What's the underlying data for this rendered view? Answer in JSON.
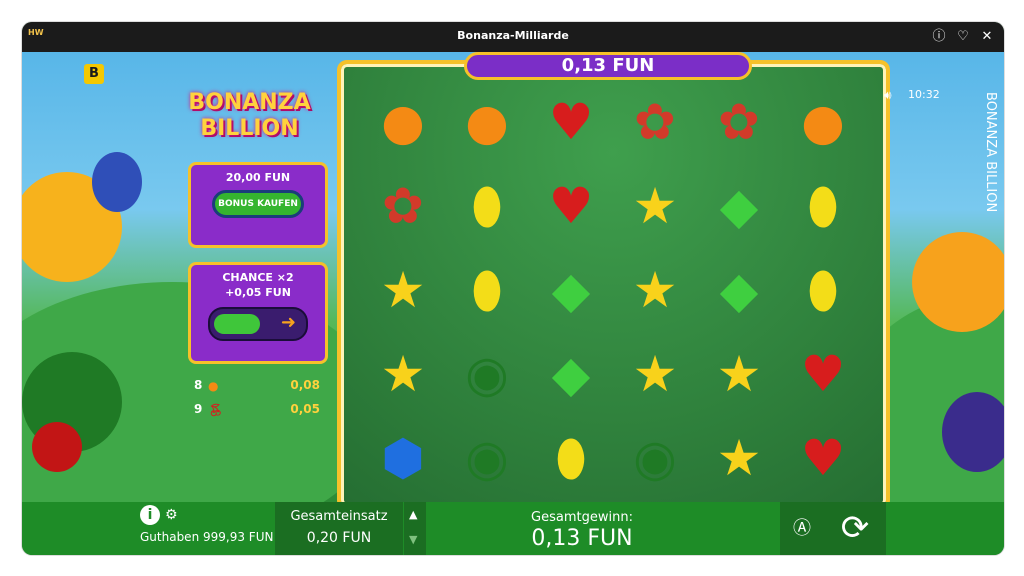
{
  "titlebar": {
    "logo": "Holly Win",
    "title": "Bonanza-Milliarde"
  },
  "game": {
    "badge": "B",
    "logo_text": "BONANZA BILLION",
    "vertical_title": "BONANZA BILLION",
    "time": "10:32",
    "win_display": "0,13 FUN",
    "buy_panel": {
      "price": "20,00 FUN",
      "button": "BONUS KAUFEN"
    },
    "chance_panel": {
      "title": "CHANCE ×2",
      "price": "+0,05 FUN"
    },
    "paytable": [
      {
        "count": "8",
        "symbol": "orange",
        "payout": "0,08"
      },
      {
        "count": "9",
        "symbol": "cherries",
        "payout": "0,05"
      }
    ],
    "grid": [
      [
        "orange",
        "orange",
        "heart",
        "scatter",
        "scatter",
        "orange"
      ],
      [
        "scatter",
        "lemon",
        "heart",
        "star",
        "gem",
        "lemon"
      ],
      [
        "star",
        "lemon",
        "gem",
        "star",
        "gem",
        "lemon"
      ],
      [
        "star",
        "watermelon",
        "gem",
        "star",
        "star",
        "heart"
      ],
      [
        "sapphire",
        "watermelon",
        "lemon",
        "watermelon",
        "star",
        "heart"
      ]
    ]
  },
  "bottom": {
    "balance": "Guthaben 999,93 FUN",
    "bet_label": "Gesamteinsatz",
    "bet_value": "0,20 FUN",
    "win_label": "Gesamtgewinn:",
    "win_value": "0,13 FUN"
  }
}
